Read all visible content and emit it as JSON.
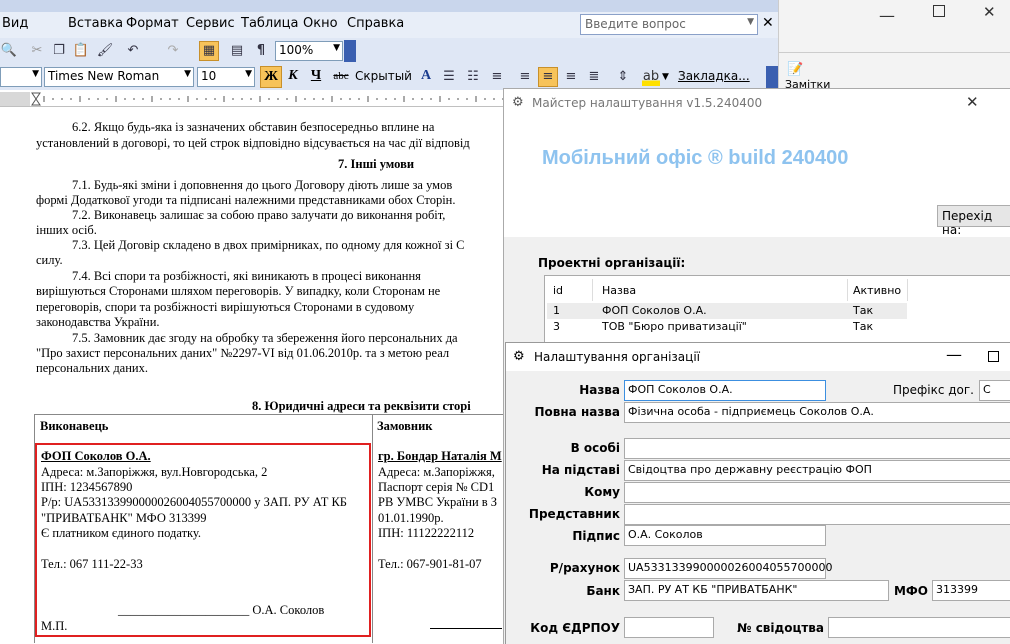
{
  "word": {
    "menu": [
      "Вид",
      "Вставка",
      "Формат",
      "Сервис",
      "Таблица",
      "Окно",
      "Справка"
    ],
    "ask_placeholder": "Введите вопрос",
    "zoom": "100%",
    "font_name": "Times New Roman",
    "font_size": "10",
    "bold": "Ж",
    "italic": "К",
    "underline": "Ч",
    "strike": "abc",
    "hidden": "Скрытый",
    "bookmark": "Закладка...",
    "doc_lines": [
      "6.2. Якщо будь-яка із зазначених обставин безпосередньо вплине на",
      "установлений в договорі, то цей строк відповідно відсувається на час дії відповід",
      "7. Інші умови",
      "7.1. Будь-які зміни і доповнення до цього Договору діють лише за умов",
      "формі Додаткової угоди та підписані належними представниками обох Сторін.",
      "7.2. Виконавець залишає за собою право залучати до виконання робіт,",
      "інших осіб.",
      "7.3. Цей Договір складено в двох примірниках, по одному для кожної зі С",
      "силу.",
      "7.4. Всі спори та розбіжності, які виникають в процесі виконання",
      "вирішуються Сторонами шляхом переговорів. У випадку, коли Сторонам не",
      "переговорів, спори та розбіжності вирішуються Сторонами в судовому",
      "законодавства України.",
      "7.5. Замовник дає згоду на обробку та збереження його персональних да",
      "\"Про захист персональних даних\" №2297-VI від 01.06.2010р. та з метою реал",
      "персональних даних."
    ],
    "section8_title": "8. Юридичні адреси та реквізити сторі",
    "col_executor": "Виконавець",
    "col_customer": "Замовник",
    "executor": {
      "name": "ФОП Соколов О.А.",
      "lines": [
        "Адреса: м.Запоріжжя, вул.Новгородська, 2",
        "ІПН: 1234567890",
        "Р/р: UA533133990000026004055700000 у ЗАП. РУ АТ КБ",
        "\"ПРИВАТБАНК\" МФО 313399",
        "Є платником єдиного податку."
      ],
      "phone": "Тел.: 067 111-22-33",
      "signature": "_____________________ О.А. Соколов",
      "stamp": "М.П."
    },
    "customer": {
      "name": "гр. Бондар Наталія М",
      "lines": [
        "Адреса: м.Запоріжжя,",
        "Паспорт серія № CD1",
        "РВ УМВС України в З",
        "01.01.1990р.",
        "ІПН: 11122222112"
      ],
      "phone": "Тел.: 067-901-81-07"
    }
  },
  "notes_button": "Замітки",
  "master": {
    "title": "Майстер налаштування v1.5.240400",
    "header": "Мобільний офіс ® build 240400",
    "goto_label": "Перехід на:",
    "projects_label": "Проектні організації:",
    "table": {
      "columns": [
        "id",
        "Назва",
        "Активно"
      ],
      "rows": [
        [
          "1",
          "ФОП Соколов О.А.",
          "Так"
        ],
        [
          "3",
          "ТОВ \"Бюро приватизації\"",
          "Так"
        ]
      ]
    }
  },
  "settings": {
    "title": "Налаштування організації",
    "fields": {
      "name_label": "Назва",
      "name_value": "ФОП Соколов О.А.",
      "prefix_label": "Префікс дог.",
      "prefix_value": "С",
      "fullname_label": "Повна назва",
      "fullname_value": "Фізична особа - підприємець Соколов О.А.",
      "person_label": "В особі",
      "person_value": "",
      "basis_label": "На підставі",
      "basis_value": "Свідоцтва про державну реєстрацію ФОП",
      "to_label": "Кому",
      "to_value": "",
      "rep_label": "Представник",
      "rep_value": "",
      "sign_label": "Підпис",
      "sign_value": "О.А. Соколов",
      "account_label": "Р/рахунок",
      "account_value": "UA533133990000026004055700000",
      "bank_label": "Банк",
      "bank_value": "ЗАП. РУ АТ КБ \"ПРИВАТБАНК\"",
      "mfo_label": "МФО",
      "mfo_value": "313399",
      "edrpou_label": "Код ЄДРПОУ",
      "edrpou_value": "",
      "cert_label": "№ свідоцтва",
      "cert_value": ""
    }
  },
  "colors": {
    "header_blue": "#8ec3ef",
    "highlight_red": "#e02020",
    "focus_blue": "#3c8fe0"
  }
}
